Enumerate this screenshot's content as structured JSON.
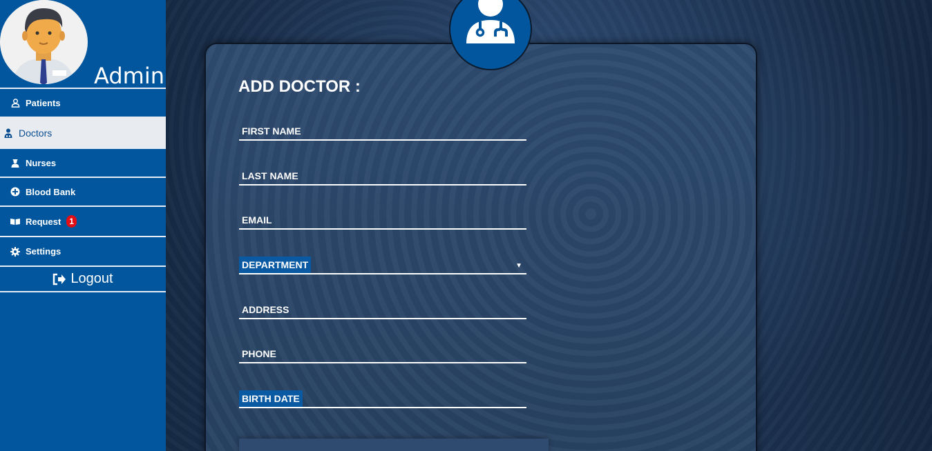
{
  "sidebar": {
    "admin_title": "Admin",
    "items": [
      {
        "label": "Patients",
        "icon": "user-icon"
      },
      {
        "label": "Doctors",
        "icon": "doctor-icon"
      },
      {
        "label": "Nurses",
        "icon": "nurse-icon"
      },
      {
        "label": "Blood Bank",
        "icon": "plus-circle-icon"
      },
      {
        "label": "Request",
        "icon": "book-icon",
        "badge": "1"
      },
      {
        "label": "Settings",
        "icon": "gear-icon"
      }
    ],
    "logout_label": "Logout"
  },
  "form": {
    "title": "ADD DOCTOR :",
    "fields": [
      {
        "label": "FIRST NAME"
      },
      {
        "label": "LAST NAME"
      },
      {
        "label": "EMAIL"
      },
      {
        "label": "DEPARTMENT"
      },
      {
        "label": "ADDRESS"
      },
      {
        "label": "PHONE"
      },
      {
        "label": "BIRTH DATE"
      }
    ]
  },
  "colors": {
    "sidebar_bg": "#01569e",
    "active_item_bg": "#e8ebef",
    "badge": "#e10f15",
    "card_bg": "#2d4a6e"
  }
}
